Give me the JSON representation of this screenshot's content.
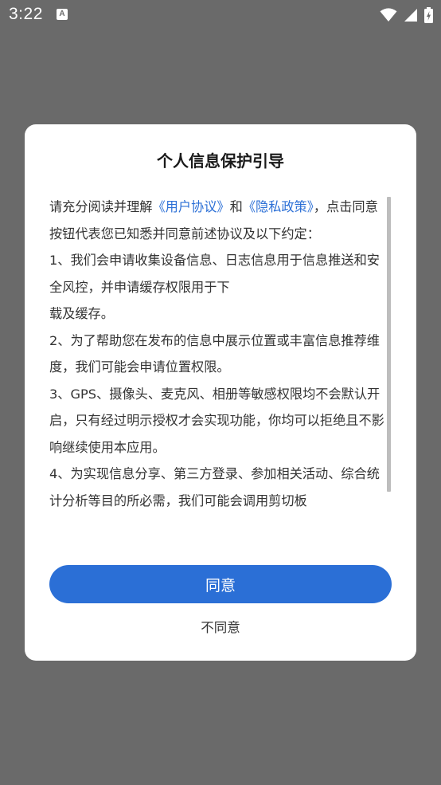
{
  "status_bar": {
    "time": "3:22",
    "notification_icon": "A",
    "icons": [
      "wifi-icon",
      "cellular-signal-icon",
      "battery-charging-icon"
    ]
  },
  "dialog": {
    "title": "个人信息保护引导",
    "intro_before": "请充分阅读并理解",
    "link_user_agreement": "《用户协议》",
    "intro_and": "和",
    "link_privacy_policy": "《隐私政策》",
    "intro_after": "，点击同意按钮代表您已知悉并同意前述协议及以下约定：",
    "item1_a": "1、我们会申请收集设备信息、日志信息用于信息推送和安全风控，并申请缓存权限用于下",
    "item1_b": "载及缓存。",
    "item2": "2、为了帮助您在发布的信息中展示位置或丰富信息推荐维度，我们可能会申请位置权限。",
    "item3": "3、GPS、摄像头、麦克风、相册等敏感权限均不会默认开启，只有经过明示授权才会实现功能，你均可以拒绝且不影响继续使用本应用。",
    "item4": "4、为实现信息分享、第三方登录、参加相关活动、综合统计分析等目的所必需，我们可能会调用剪切板",
    "agree_label": "同意",
    "disagree_label": "不同意"
  },
  "colors": {
    "accent": "#2b6fd6",
    "overlay": "#6a6a6a",
    "dialog_bg": "#ffffff",
    "text": "#333333"
  }
}
